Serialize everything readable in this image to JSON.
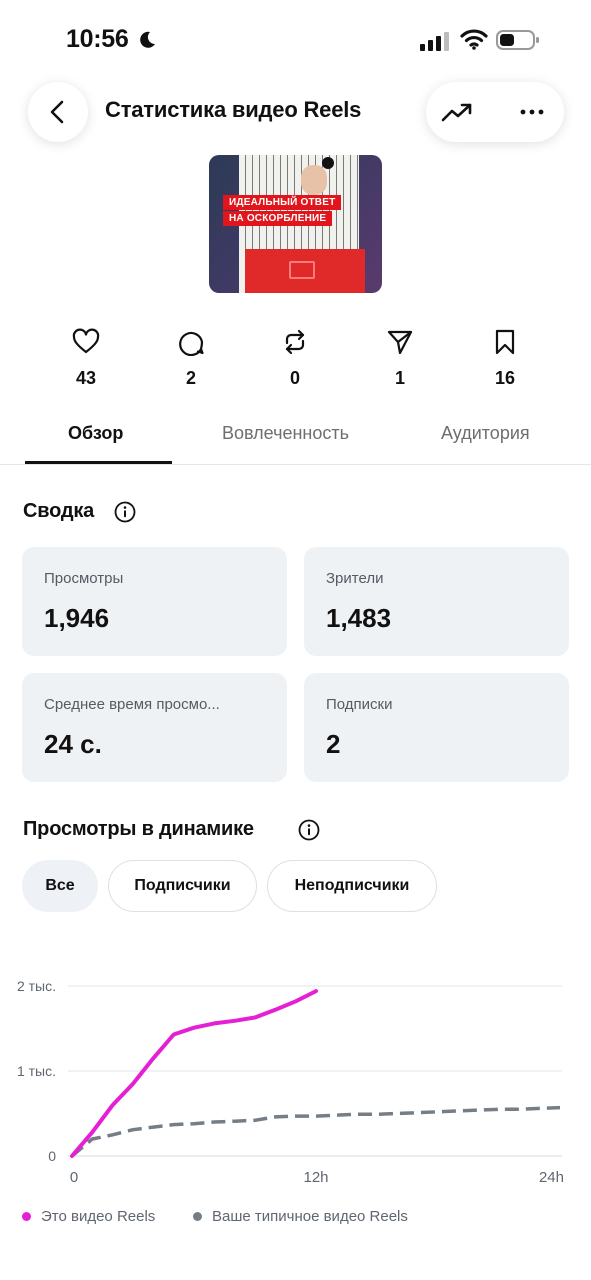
{
  "status_bar": {
    "time": "10:56"
  },
  "header": {
    "title": "Статистика видео Reels"
  },
  "thumbnail": {
    "caption_line1": "ИДЕАЛЬНЫЙ ОТВЕТ",
    "caption_line2": "НА ОСКОРБЛЕНИЕ"
  },
  "counters": [
    {
      "icon": "heart-icon",
      "value": "43"
    },
    {
      "icon": "comment-icon",
      "value": "2"
    },
    {
      "icon": "repost-icon",
      "value": "0"
    },
    {
      "icon": "send-icon",
      "value": "1"
    },
    {
      "icon": "bookmark-icon",
      "value": "16"
    }
  ],
  "tabs": [
    {
      "label": "Обзор",
      "active": true
    },
    {
      "label": "Вовлеченность",
      "active": false
    },
    {
      "label": "Аудитория",
      "active": false
    }
  ],
  "summary": {
    "title": "Сводка",
    "cards": [
      {
        "label": "Просмотры",
        "value": "1,946"
      },
      {
        "label": "Зрители",
        "value": "1,483"
      },
      {
        "label": "Среднее время просмо...",
        "value": "24 с."
      },
      {
        "label": "Подписки",
        "value": "2"
      }
    ]
  },
  "views_dynamics": {
    "title": "Просмотры в динамике",
    "filters": [
      {
        "label": "Все",
        "selected": true
      },
      {
        "label": "Подписчики",
        "selected": false
      },
      {
        "label": "Неподписчики",
        "selected": false
      }
    ]
  },
  "chart_data": {
    "type": "line",
    "title": "",
    "xlabel": "",
    "ylabel": "",
    "x_tick_labels": [
      "0",
      "12h",
      "24h"
    ],
    "y_tick_labels": [
      "0",
      "1 тыс.",
      "2 тыс."
    ],
    "xlim": [
      0,
      24
    ],
    "ylim": [
      0,
      2000
    ],
    "grid": true,
    "legend_position": "bottom",
    "series": [
      {
        "name": "Это видео Reels",
        "color": "#e51fd3",
        "style": "solid",
        "x": [
          0,
          1,
          2,
          3,
          4,
          5,
          6,
          7,
          8,
          9,
          10,
          11,
          12
        ],
        "y": [
          0,
          280,
          600,
          850,
          1150,
          1430,
          1510,
          1560,
          1590,
          1630,
          1720,
          1820,
          1940
        ]
      },
      {
        "name": "Ваше типичное видео Reels",
        "color": "#757d87",
        "style": "dashed",
        "x": [
          0,
          1,
          2,
          3,
          4,
          5,
          6,
          7,
          8,
          9,
          10,
          11,
          12,
          13,
          14,
          15,
          16,
          17,
          18,
          19,
          20,
          21,
          22,
          23,
          24
        ],
        "y": [
          0,
          200,
          250,
          310,
          340,
          370,
          380,
          400,
          410,
          420,
          460,
          470,
          470,
          480,
          490,
          490,
          500,
          510,
          520,
          530,
          540,
          550,
          550,
          560,
          570
        ]
      }
    ]
  },
  "colors": {
    "accent_series": "#e51fd3",
    "typical_series": "#757d87",
    "card_background": "#eff2f5"
  }
}
